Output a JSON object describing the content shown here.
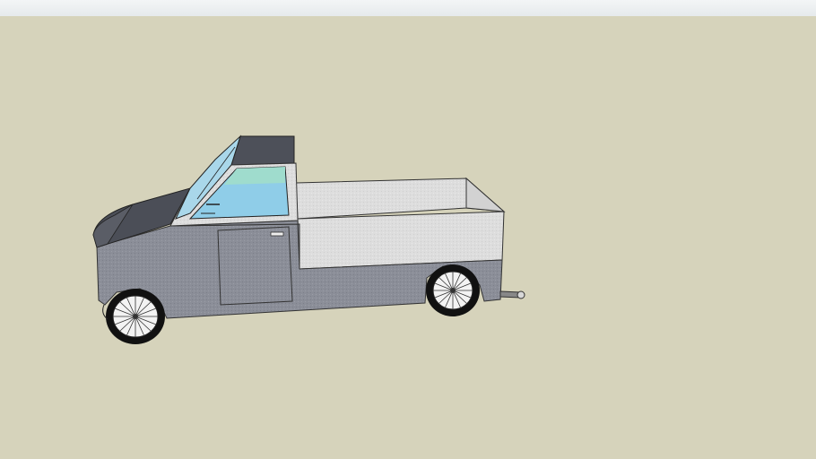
{
  "scene": {
    "description_colors": {
      "background": "#d6d3bb",
      "top_bar": "#eef1f2",
      "body_gray": "#8a8d96",
      "body_light": "#dcdcdc",
      "glass": "#9ed3ec",
      "tire": "#111111"
    }
  }
}
